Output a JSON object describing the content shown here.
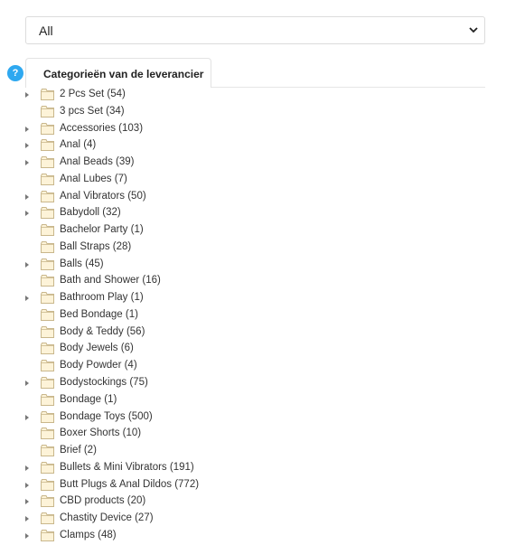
{
  "filter": {
    "selected": "All"
  },
  "help": {
    "glyph": "?"
  },
  "tabs": [
    {
      "label": "Categorieën van de leverancier",
      "active": true
    }
  ],
  "colors": {
    "help_badge": "#2ea8f0",
    "folder_fill": "#fdf3d8",
    "folder_stroke": "#c9b78c"
  },
  "tree": {
    "items": [
      {
        "label": "2 Pcs Set (54)",
        "expandable": true
      },
      {
        "label": "3 pcs Set (34)",
        "expandable": false
      },
      {
        "label": "Accessories (103)",
        "expandable": true
      },
      {
        "label": "Anal (4)",
        "expandable": true
      },
      {
        "label": "Anal Beads (39)",
        "expandable": true
      },
      {
        "label": "Anal Lubes (7)",
        "expandable": false
      },
      {
        "label": "Anal Vibrators (50)",
        "expandable": true
      },
      {
        "label": "Babydoll (32)",
        "expandable": true
      },
      {
        "label": "Bachelor Party (1)",
        "expandable": false
      },
      {
        "label": "Ball Straps (28)",
        "expandable": false
      },
      {
        "label": "Balls (45)",
        "expandable": true
      },
      {
        "label": "Bath and Shower (16)",
        "expandable": false
      },
      {
        "label": "Bathroom Play (1)",
        "expandable": true
      },
      {
        "label": "Bed Bondage (1)",
        "expandable": false
      },
      {
        "label": "Body & Teddy (56)",
        "expandable": false
      },
      {
        "label": "Body Jewels (6)",
        "expandable": false
      },
      {
        "label": "Body Powder (4)",
        "expandable": false
      },
      {
        "label": "Bodystockings (75)",
        "expandable": true
      },
      {
        "label": "Bondage (1)",
        "expandable": false
      },
      {
        "label": "Bondage Toys (500)",
        "expandable": true
      },
      {
        "label": "Boxer Shorts (10)",
        "expandable": false
      },
      {
        "label": "Brief (2)",
        "expandable": false
      },
      {
        "label": "Bullets & Mini Vibrators (191)",
        "expandable": true
      },
      {
        "label": "Butt Plugs & Anal Dildos (772)",
        "expandable": true
      },
      {
        "label": "CBD products (20)",
        "expandable": true
      },
      {
        "label": "Chastity Device (27)",
        "expandable": true
      },
      {
        "label": "Clamps (48)",
        "expandable": true
      }
    ]
  }
}
